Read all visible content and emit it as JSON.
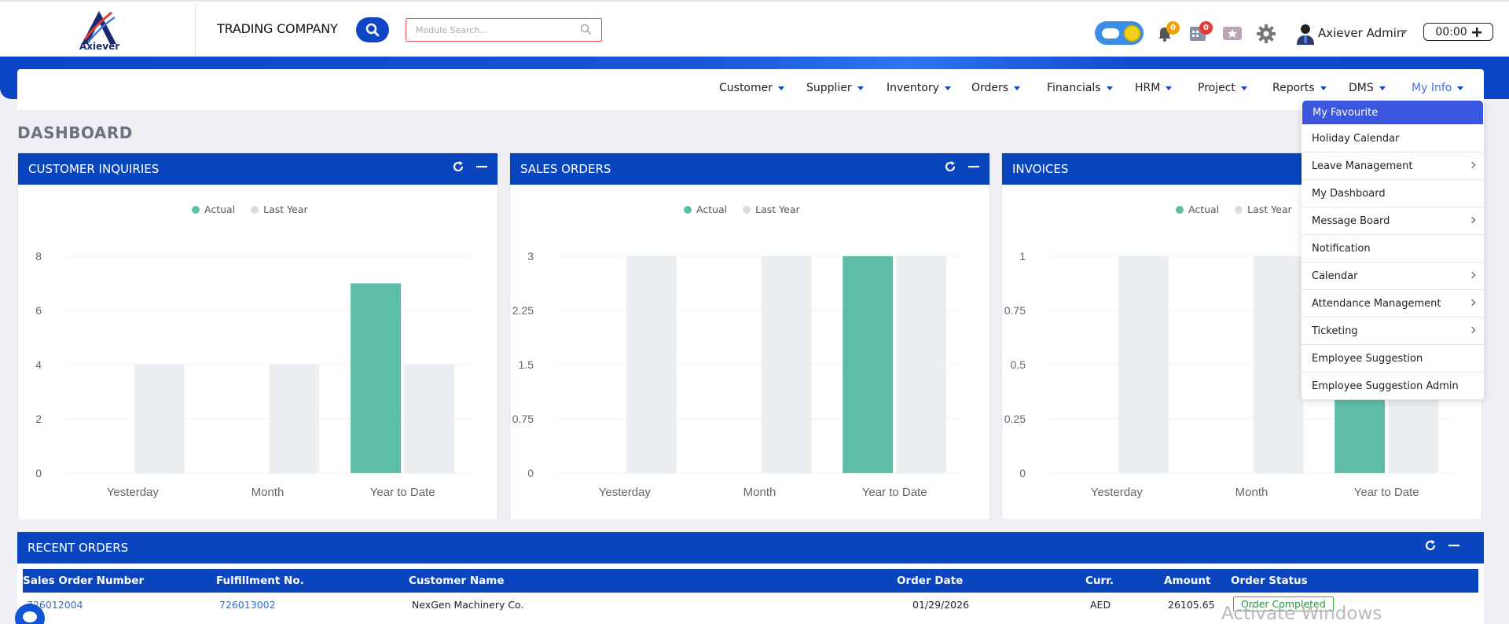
{
  "header": {
    "logo_text": "Axiever",
    "company": "TRADING COMPANY",
    "search_placeholder": "Module Search...",
    "notif_badge": "0",
    "tasks_badge": "0",
    "user_name": "Axiever Admin",
    "timer": "00:00"
  },
  "nav": {
    "items": [
      "Customer",
      "Supplier",
      "Inventory",
      "Orders",
      "Financials",
      "HRM",
      "Project",
      "Reports",
      "DMS",
      "My Info"
    ]
  },
  "dashboard_title": "DASHBOARD",
  "legend": {
    "actual": "Actual",
    "last_year": "Last Year"
  },
  "colors": {
    "actual": "#5dbda6",
    "last_year": "#eceff2",
    "header": "#0b45bd"
  },
  "chart_data": [
    {
      "type": "bar",
      "title": "CUSTOMER INQUIRIES",
      "categories": [
        "Yesterday",
        "Month",
        "Year to Date"
      ],
      "series": [
        {
          "name": "Actual",
          "values": [
            0,
            0,
            7
          ]
        },
        {
          "name": "Last Year",
          "values": [
            4,
            4,
            4
          ]
        }
      ],
      "ylim": [
        0,
        8
      ],
      "yticks": [
        "0",
        "2",
        "4",
        "6",
        "8"
      ],
      "ytick_values": [
        0,
        2,
        4,
        6,
        8
      ]
    },
    {
      "type": "bar",
      "title": "SALES ORDERS",
      "categories": [
        "Yesterday",
        "Month",
        "Year to Date"
      ],
      "series": [
        {
          "name": "Actual",
          "values": [
            0,
            0,
            3
          ]
        },
        {
          "name": "Last Year",
          "values": [
            3,
            3,
            3
          ]
        }
      ],
      "ylim": [
        0,
        3
      ],
      "yticks": [
        "0",
        "0.75",
        "1.5",
        "2.25",
        "3"
      ],
      "ytick_values": [
        0,
        0.75,
        1.5,
        2.25,
        3
      ]
    },
    {
      "type": "bar",
      "title": "INVOICES",
      "categories": [
        "Yesterday",
        "Month",
        "Year to Date"
      ],
      "series": [
        {
          "name": "Actual",
          "values": [
            0,
            0,
            0.5
          ]
        },
        {
          "name": "Last Year",
          "values": [
            1,
            1,
            1
          ]
        }
      ],
      "ylim": [
        0,
        1
      ],
      "yticks": [
        "0",
        "0.25",
        "0.5",
        "0.75",
        "1"
      ],
      "ytick_values": [
        0,
        0.25,
        0.5,
        0.75,
        1
      ]
    }
  ],
  "my_info_menu": [
    {
      "label": "My Favourite",
      "active": true,
      "sub": false
    },
    {
      "label": "Holiday Calendar",
      "sub": false
    },
    {
      "label": "Leave Management",
      "sub": true
    },
    {
      "label": "My Dashboard",
      "sub": false
    },
    {
      "label": "Message Board",
      "sub": true
    },
    {
      "label": "Notification",
      "sub": false
    },
    {
      "label": "Calendar",
      "sub": true
    },
    {
      "label": "Attendance Management",
      "sub": true
    },
    {
      "label": "Ticketing",
      "sub": true
    },
    {
      "label": "Employee Suggestion",
      "sub": false
    },
    {
      "label": "Employee Suggestion Admin",
      "sub": false
    }
  ],
  "recent_orders": {
    "title": "RECENT ORDERS",
    "columns": [
      "Sales Order Number",
      "Fulfillment No.",
      "Customer Name",
      "Order Date",
      "Curr.",
      "Amount",
      "Order Status"
    ],
    "rows": [
      {
        "so": "726012004",
        "ff": "726013002",
        "customer": "NexGen Machinery Co.",
        "date": "01/29/2026",
        "curr": "AED",
        "amount": "26105.65",
        "status": "Order Completed"
      }
    ]
  },
  "watermark": "Activate Windows"
}
